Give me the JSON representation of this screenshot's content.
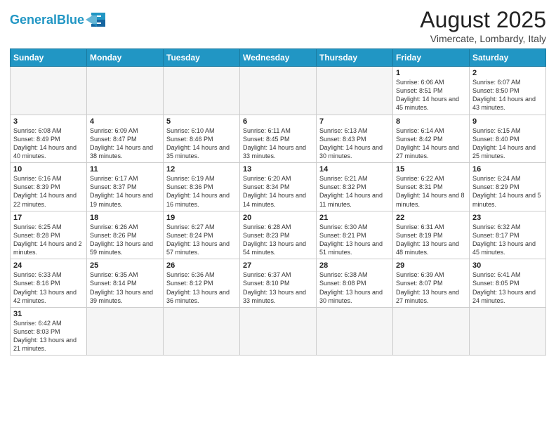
{
  "logo": {
    "text_general": "General",
    "text_blue": "Blue"
  },
  "title": "August 2025",
  "subtitle": "Vimercate, Lombardy, Italy",
  "weekdays": [
    "Sunday",
    "Monday",
    "Tuesday",
    "Wednesday",
    "Thursday",
    "Friday",
    "Saturday"
  ],
  "weeks": [
    [
      {
        "day": "",
        "info": "",
        "empty": true
      },
      {
        "day": "",
        "info": "",
        "empty": true
      },
      {
        "day": "",
        "info": "",
        "empty": true
      },
      {
        "day": "",
        "info": "",
        "empty": true
      },
      {
        "day": "",
        "info": "",
        "empty": true
      },
      {
        "day": "1",
        "info": "Sunrise: 6:06 AM\nSunset: 8:51 PM\nDaylight: 14 hours and 45 minutes."
      },
      {
        "day": "2",
        "info": "Sunrise: 6:07 AM\nSunset: 8:50 PM\nDaylight: 14 hours and 43 minutes."
      }
    ],
    [
      {
        "day": "3",
        "info": "Sunrise: 6:08 AM\nSunset: 8:49 PM\nDaylight: 14 hours and 40 minutes."
      },
      {
        "day": "4",
        "info": "Sunrise: 6:09 AM\nSunset: 8:47 PM\nDaylight: 14 hours and 38 minutes."
      },
      {
        "day": "5",
        "info": "Sunrise: 6:10 AM\nSunset: 8:46 PM\nDaylight: 14 hours and 35 minutes."
      },
      {
        "day": "6",
        "info": "Sunrise: 6:11 AM\nSunset: 8:45 PM\nDaylight: 14 hours and 33 minutes."
      },
      {
        "day": "7",
        "info": "Sunrise: 6:13 AM\nSunset: 8:43 PM\nDaylight: 14 hours and 30 minutes."
      },
      {
        "day": "8",
        "info": "Sunrise: 6:14 AM\nSunset: 8:42 PM\nDaylight: 14 hours and 27 minutes."
      },
      {
        "day": "9",
        "info": "Sunrise: 6:15 AM\nSunset: 8:40 PM\nDaylight: 14 hours and 25 minutes."
      }
    ],
    [
      {
        "day": "10",
        "info": "Sunrise: 6:16 AM\nSunset: 8:39 PM\nDaylight: 14 hours and 22 minutes."
      },
      {
        "day": "11",
        "info": "Sunrise: 6:17 AM\nSunset: 8:37 PM\nDaylight: 14 hours and 19 minutes."
      },
      {
        "day": "12",
        "info": "Sunrise: 6:19 AM\nSunset: 8:36 PM\nDaylight: 14 hours and 16 minutes."
      },
      {
        "day": "13",
        "info": "Sunrise: 6:20 AM\nSunset: 8:34 PM\nDaylight: 14 hours and 14 minutes."
      },
      {
        "day": "14",
        "info": "Sunrise: 6:21 AM\nSunset: 8:32 PM\nDaylight: 14 hours and 11 minutes."
      },
      {
        "day": "15",
        "info": "Sunrise: 6:22 AM\nSunset: 8:31 PM\nDaylight: 14 hours and 8 minutes."
      },
      {
        "day": "16",
        "info": "Sunrise: 6:24 AM\nSunset: 8:29 PM\nDaylight: 14 hours and 5 minutes."
      }
    ],
    [
      {
        "day": "17",
        "info": "Sunrise: 6:25 AM\nSunset: 8:28 PM\nDaylight: 14 hours and 2 minutes."
      },
      {
        "day": "18",
        "info": "Sunrise: 6:26 AM\nSunset: 8:26 PM\nDaylight: 13 hours and 59 minutes."
      },
      {
        "day": "19",
        "info": "Sunrise: 6:27 AM\nSunset: 8:24 PM\nDaylight: 13 hours and 57 minutes."
      },
      {
        "day": "20",
        "info": "Sunrise: 6:28 AM\nSunset: 8:23 PM\nDaylight: 13 hours and 54 minutes."
      },
      {
        "day": "21",
        "info": "Sunrise: 6:30 AM\nSunset: 8:21 PM\nDaylight: 13 hours and 51 minutes."
      },
      {
        "day": "22",
        "info": "Sunrise: 6:31 AM\nSunset: 8:19 PM\nDaylight: 13 hours and 48 minutes."
      },
      {
        "day": "23",
        "info": "Sunrise: 6:32 AM\nSunset: 8:17 PM\nDaylight: 13 hours and 45 minutes."
      }
    ],
    [
      {
        "day": "24",
        "info": "Sunrise: 6:33 AM\nSunset: 8:16 PM\nDaylight: 13 hours and 42 minutes."
      },
      {
        "day": "25",
        "info": "Sunrise: 6:35 AM\nSunset: 8:14 PM\nDaylight: 13 hours and 39 minutes."
      },
      {
        "day": "26",
        "info": "Sunrise: 6:36 AM\nSunset: 8:12 PM\nDaylight: 13 hours and 36 minutes."
      },
      {
        "day": "27",
        "info": "Sunrise: 6:37 AM\nSunset: 8:10 PM\nDaylight: 13 hours and 33 minutes."
      },
      {
        "day": "28",
        "info": "Sunrise: 6:38 AM\nSunset: 8:08 PM\nDaylight: 13 hours and 30 minutes."
      },
      {
        "day": "29",
        "info": "Sunrise: 6:39 AM\nSunset: 8:07 PM\nDaylight: 13 hours and 27 minutes."
      },
      {
        "day": "30",
        "info": "Sunrise: 6:41 AM\nSunset: 8:05 PM\nDaylight: 13 hours and 24 minutes."
      }
    ],
    [
      {
        "day": "31",
        "info": "Sunrise: 6:42 AM\nSunset: 8:03 PM\nDaylight: 13 hours and 21 minutes.",
        "lastrow": true
      },
      {
        "day": "",
        "info": "",
        "empty": true,
        "lastrow": true
      },
      {
        "day": "",
        "info": "",
        "empty": true,
        "lastrow": true
      },
      {
        "day": "",
        "info": "",
        "empty": true,
        "lastrow": true
      },
      {
        "day": "",
        "info": "",
        "empty": true,
        "lastrow": true
      },
      {
        "day": "",
        "info": "",
        "empty": true,
        "lastrow": true
      },
      {
        "day": "",
        "info": "",
        "empty": true,
        "lastrow": true
      }
    ]
  ]
}
